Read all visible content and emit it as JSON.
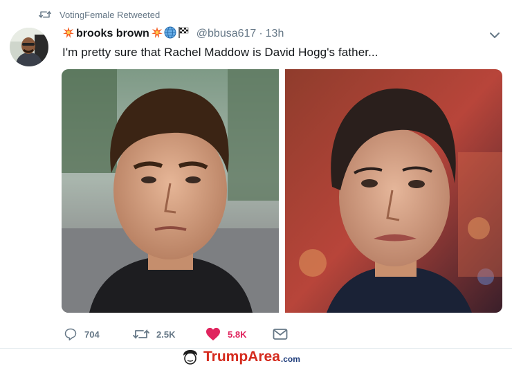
{
  "retweet": {
    "text": "VotingFemale Retweeted",
    "icon": "retweet-icon"
  },
  "tweet": {
    "display_name": "brooks brown",
    "handle": "@bbusa617",
    "separator": "·",
    "time": "13h",
    "text": "I'm pretty sure that Rachel Maddow is David Hogg's father...",
    "name_emojis": [
      "collision-emoji",
      "collision-emoji",
      "globe-emoji",
      "checkered-flag-emoji"
    ]
  },
  "actions": {
    "reply_count": "704",
    "retweet_count": "2.5K",
    "like_count": "5.8K"
  },
  "colors": {
    "like_red": "#e0245e",
    "gray": "#657786",
    "watermark_red": "#d52b1e",
    "watermark_blue": "#1d3b7a"
  },
  "watermark": {
    "brand_trump": "Trump",
    "brand_area": "Area",
    "brand_tld": ".com"
  }
}
